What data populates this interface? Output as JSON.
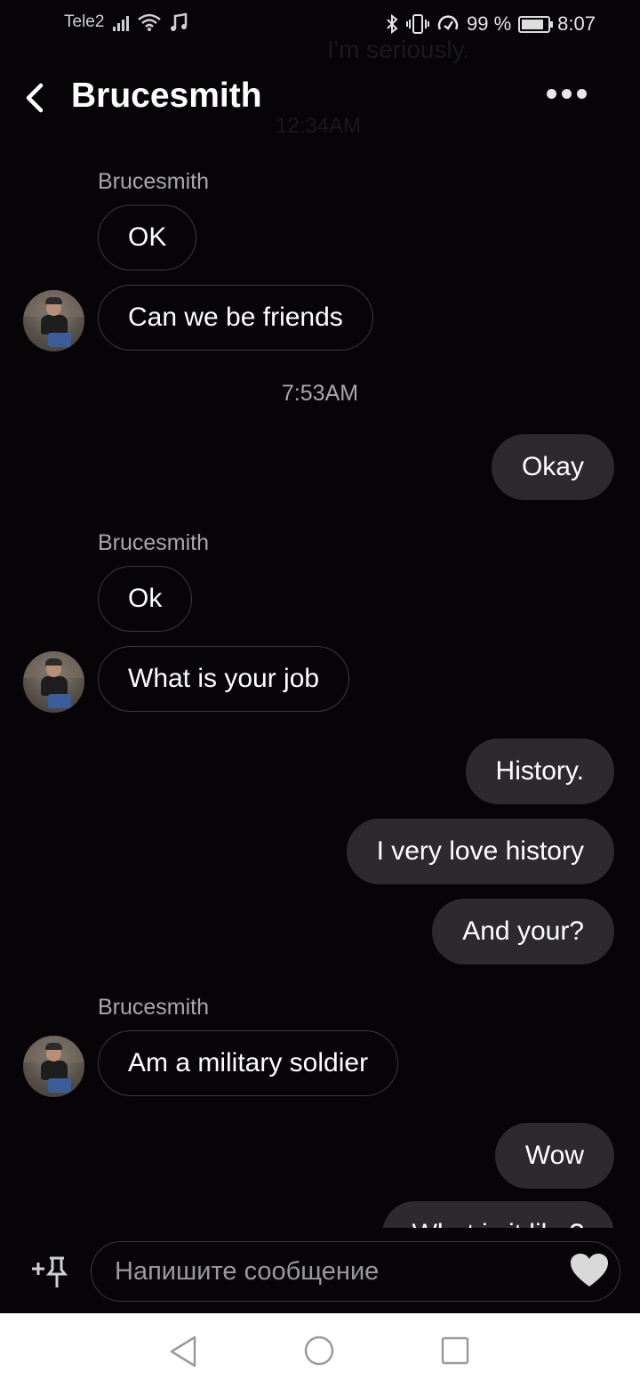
{
  "status_bar": {
    "carrier": "Tele2",
    "battery": "99 %",
    "battery_level": 0.99,
    "time": "8:07",
    "icons": [
      "signal-icon",
      "wifi-icon",
      "music-icon",
      "bluetooth-icon",
      "vibrate-icon",
      "data-saver-icon",
      "battery-icon"
    ]
  },
  "ghost": {
    "line1": "I'm seriously.",
    "line2": "12:34AM"
  },
  "header": {
    "title": "Brucesmith",
    "back_icon": "chevron-left-icon",
    "more_icon": "more-horizontal-icon"
  },
  "messages": {
    "sender_1": "Brucesmith",
    "m1": "OK",
    "m2": "Can we be friends",
    "timestamp": "7:53AM",
    "m3": "Okay",
    "sender_2": "Brucesmith",
    "m4": "Ok",
    "m5": "What is your job",
    "m6": "History.",
    "m7": "I very love history",
    "m8": "And your?",
    "sender_3": "Brucesmith",
    "m9": "Am a military soldier",
    "m10": "Wow",
    "m11": "What is it like?"
  },
  "composer": {
    "placeholder": "Напишите сообщение",
    "attach_icon": "add-pin-icon",
    "like_icon": "heart-icon"
  },
  "nav_bar": {
    "icons": [
      "nav-back-icon",
      "nav-home-icon",
      "nav-recents-icon"
    ]
  },
  "colors": {
    "background": "#060407",
    "outgoing_bubble": "#2c2a2e",
    "incoming_border": "#3c3c3c",
    "secondary_text": "#a8a8a8"
  }
}
